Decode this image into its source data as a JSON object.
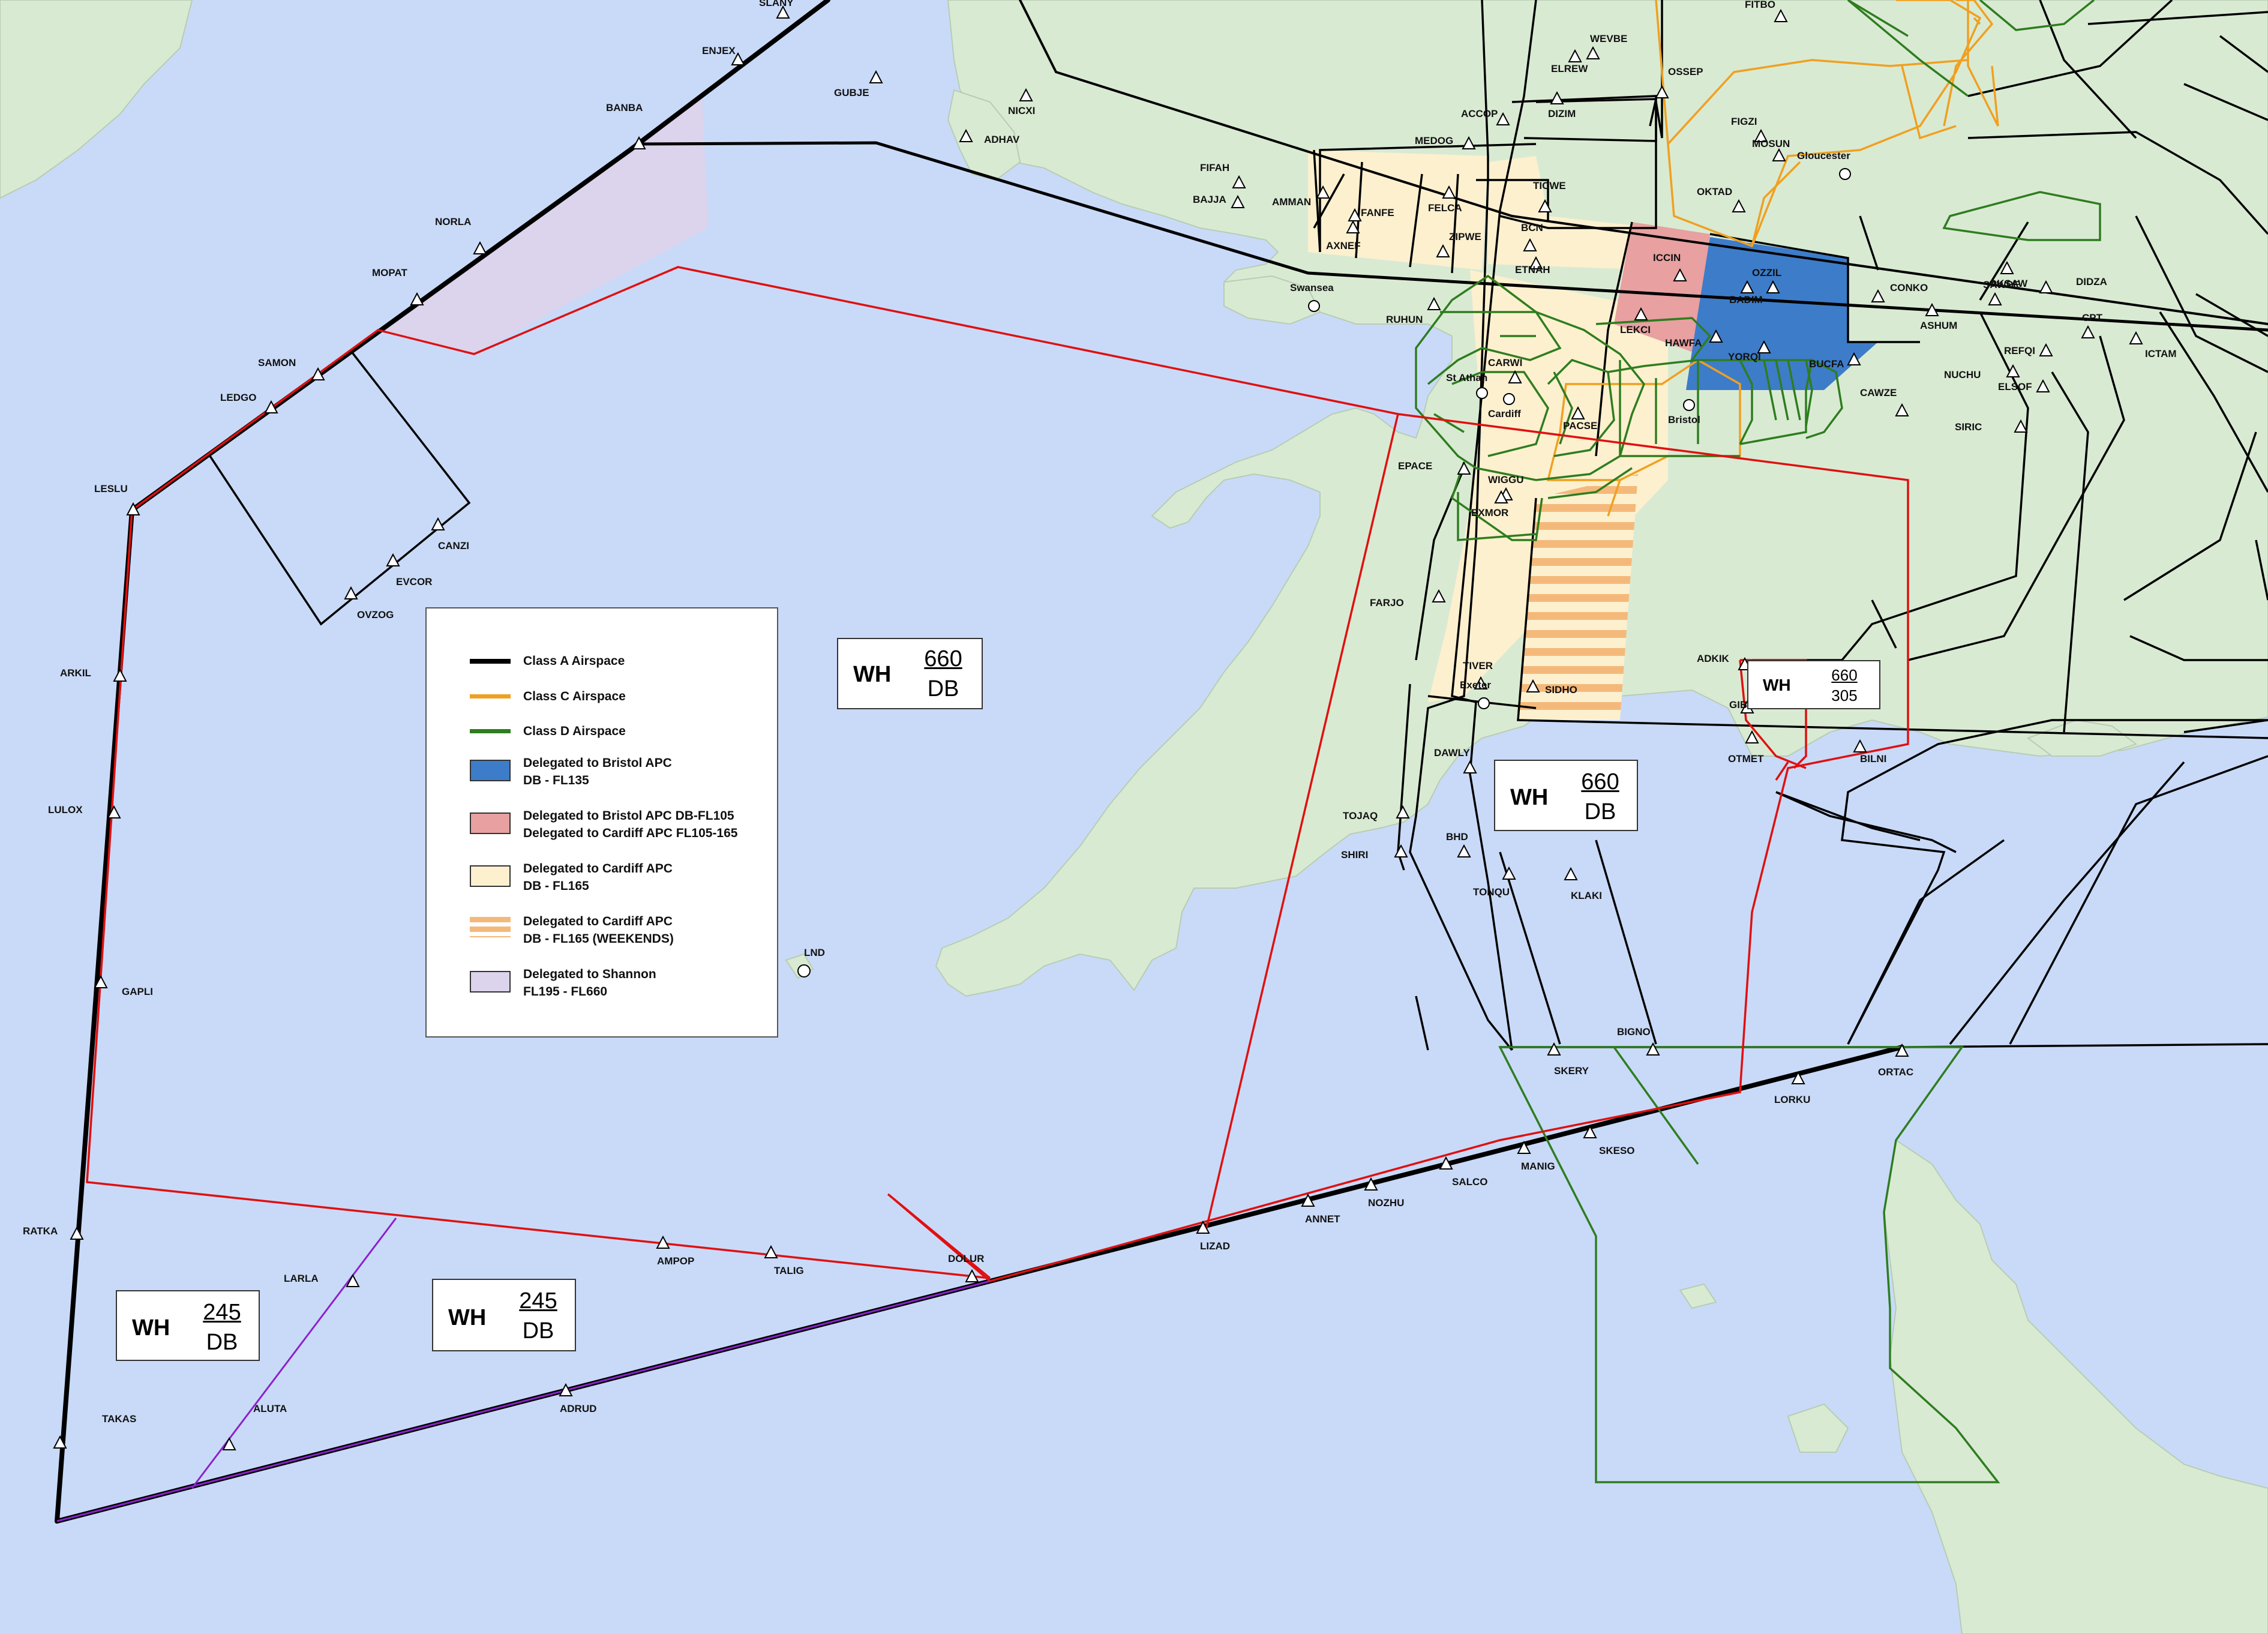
{
  "legend": {
    "items": [
      {
        "line1": "Class A Airspace",
        "line2": "",
        "color": "#000000",
        "kind": "line"
      },
      {
        "line1": "Class C Airspace",
        "line2": "",
        "color": "#f0a020",
        "kind": "line"
      },
      {
        "line1": "Class D Airspace",
        "line2": "",
        "color": "#2e7d1f",
        "kind": "line"
      },
      {
        "line1": "Delegated to Bristol APC",
        "line2": "DB - FL135",
        "color": "#3d7cc9",
        "kind": "fill"
      },
      {
        "line1": "Delegated to Bristol APC DB-FL105",
        "line2": "Delegated to Cardiff APC FL105-165",
        "color": "#e8a0a0",
        "kind": "fill"
      },
      {
        "line1": "Delegated to Cardiff APC",
        "line2": "DB - FL165",
        "color": "#fdf0cf",
        "kind": "fill"
      },
      {
        "line1": "Delegated to Cardiff APC",
        "line2": "DB - FL165 (WEEKENDS)",
        "color": "#f4b97a",
        "kind": "stripe"
      },
      {
        "line1": "Delegated to Shannon",
        "line2": "FL195 - FL660",
        "color": "#dcd3ec",
        "kind": "fill"
      }
    ]
  },
  "boxes": [
    {
      "w": "WH",
      "top": "660",
      "bottom": "DB"
    },
    {
      "w": "WH",
      "top": "660",
      "bottom": "DB"
    },
    {
      "w": "WH",
      "top": "660",
      "bottom": "305"
    },
    {
      "w": "WH",
      "top": "245",
      "bottom": "DB"
    },
    {
      "w": "WH",
      "top": "245",
      "bottom": "DB"
    }
  ],
  "waypoints": [
    "SLANY",
    "ENJEX",
    "BANBA",
    "GUBJE",
    "NICXI",
    "ADHAV",
    "NORLA",
    "MOPAT",
    "SAMON",
    "LEDGO",
    "LESLU",
    "ARKIL",
    "LULOX",
    "GAPLI",
    "RATKA",
    "TAKAS",
    "LARLA",
    "ALUTA",
    "ADRUD",
    "AMPOP",
    "TALIG",
    "DOLUR",
    "LIZAD",
    "ANNET",
    "NOZHU",
    "SALCO",
    "MANIG",
    "SKESO",
    "LORKU",
    "ORTAC",
    "BIGNO",
    "SKERY",
    "CANZI",
    "EVCOR",
    "OVZOG",
    "FIFAH",
    "BAJJA",
    "AMMAN",
    "FANFE",
    "AXNEF",
    "FELCA",
    "ZIPWE",
    "ACCOP",
    "MEDOG",
    "DIZIM",
    "ELREW",
    "WEVBE",
    "OSSEP",
    "FITBO",
    "FIGZI",
    "MOSUN",
    "OKTAD",
    "TICWE",
    "BCN",
    "ETNAH",
    "ICCIN",
    "OZZIL",
    "BADIM",
    "LEKCI",
    "HAWFA",
    "YORQI",
    "BUCFA",
    "RUHUN",
    "CARWI",
    "PACSE",
    "WIGGU",
    "EXMOR",
    "EPACE",
    "FARJO",
    "TIVER",
    "SIDHO",
    "DAWLY",
    "TOJAQ",
    "SHIRI",
    "BHD",
    "TONQU",
    "KLAKI",
    "ADKIK",
    "GIBSO",
    "OTMET",
    "BILNI",
    "CONKO",
    "ASHUM",
    "SAWPE",
    "OKSAW",
    "DIDZA",
    "CPT",
    "ICTAM",
    "REFQI",
    "NUCHU",
    "ELSOF",
    "CAWZE",
    "SIRIC",
    "LND"
  ],
  "places": [
    "Swansea",
    "St Athan",
    "Cardiff",
    "Bristol",
    "Exeter",
    "Gloucester"
  ]
}
